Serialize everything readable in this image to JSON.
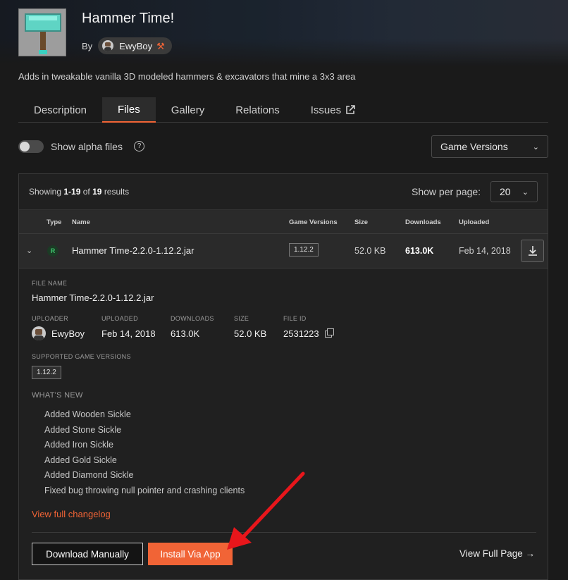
{
  "project": {
    "title": "Hammer Time!",
    "by_label": "By",
    "author": "EwyBoy",
    "author_badge_icon": "hammer-pick-icon",
    "summary": "Adds in tweakable vanilla 3D modeled hammers & excavators that mine a 3x3 area"
  },
  "tabs": [
    {
      "label": "Description",
      "active": false
    },
    {
      "label": "Files",
      "active": true
    },
    {
      "label": "Gallery",
      "active": false
    },
    {
      "label": "Relations",
      "active": false
    },
    {
      "label": "Issues",
      "active": false,
      "external_icon": "external-link-icon"
    }
  ],
  "filters": {
    "alpha_label": "Show alpha files",
    "alpha_enabled": false,
    "help_icon": "question-icon",
    "game_versions_label": "Game Versions"
  },
  "results": {
    "showing_prefix": "Showing",
    "range": "1-19",
    "of_label": "of",
    "total": "19",
    "suffix": "results",
    "per_page_label": "Show per page:",
    "per_page_value": "20"
  },
  "table": {
    "headers": {
      "type": "Type",
      "name": "Name",
      "game_versions": "Game Versions",
      "size": "Size",
      "downloads": "Downloads",
      "uploaded": "Uploaded"
    },
    "row": {
      "type_badge": "R",
      "name": "Hammer Time-2.2.0-1.12.2.jar",
      "game_version": "1.12.2",
      "size": "52.0 KB",
      "downloads": "613.0K",
      "uploaded": "Feb 14, 2018"
    }
  },
  "details": {
    "file_name_label": "FILE NAME",
    "file_name": "Hammer Time-2.2.0-1.12.2.jar",
    "uploader_label": "UPLOADER",
    "uploader": "EwyBoy",
    "uploaded_label": "UPLOADED",
    "uploaded": "Feb 14, 2018",
    "downloads_label": "DOWNLOADS",
    "downloads": "613.0K",
    "size_label": "SIZE",
    "size": "52.0 KB",
    "file_id_label": "FILE ID",
    "file_id": "2531223",
    "supported_label": "SUPPORTED GAME VERSIONS",
    "supported_version": "1.12.2",
    "whats_new_label": "WHAT'S NEW",
    "changelog": [
      "Added Wooden Sickle",
      "Added Stone Sickle",
      "Added Iron Sickle",
      "Added Gold Sickle",
      "Added Diamond Sickle",
      "Fixed bug throwing null pointer and crashing clients"
    ],
    "view_changelog": "View full changelog",
    "download_manually": "Download Manually",
    "install_via_app": "Install Via App",
    "view_full_page": "View Full Page →"
  },
  "colors": {
    "accent": "#f16436",
    "annotation_arrow": "#e8161b",
    "release_green": "#3ec46d"
  }
}
